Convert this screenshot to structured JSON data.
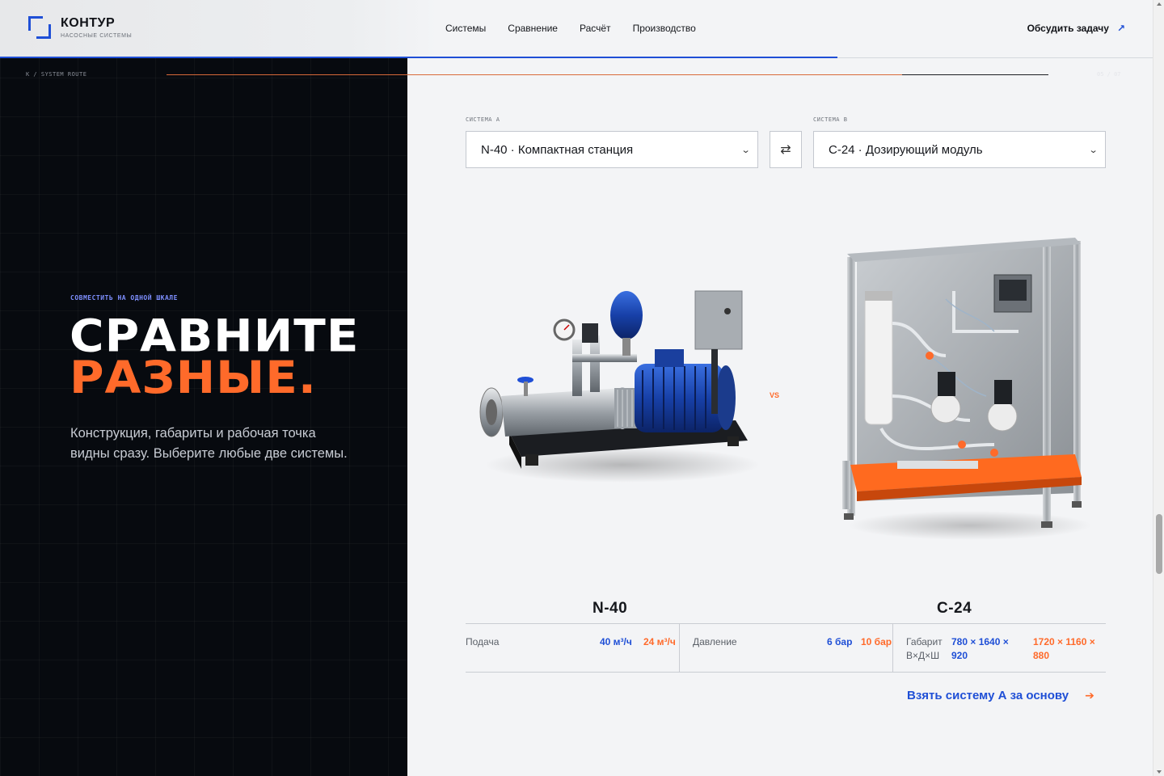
{
  "brand": {
    "name": "КОНТУР",
    "tagline": "НАСОСНЫЕ СИСТЕМЫ"
  },
  "nav": [
    "Системы",
    "Сравнение",
    "Расчёт",
    "Производство"
  ],
  "cta": {
    "label": "Обсудить задачу",
    "icon": "arrow-up-right-icon"
  },
  "route": {
    "label": "К / SYSTEM ROUTE",
    "count": "05 / 07"
  },
  "hero": {
    "eyebrow": "СОВМЕСТИТЬ НА ОДНОЙ ШКАЛЕ",
    "title_line1": "СРАВНИТЕ",
    "title_line2": "РАЗНЫЕ.",
    "description": "Конструкция, габариты и рабочая точка видны сразу. Выберите любые две системы."
  },
  "selectors": {
    "a": {
      "label": "СИСТЕМА А",
      "value": "N-40 · Компактная станция"
    },
    "b": {
      "label": "СИСТЕМА В",
      "value": "С-24 · Дозирующий модуль"
    },
    "swap_icon": "swap-arrows-icon"
  },
  "compare": {
    "vs": "VS",
    "product_a": "N-40",
    "product_b": "С-24"
  },
  "specs": [
    {
      "label": "Подача",
      "a": "40 м³/ч",
      "b": "24 м³/ч"
    },
    {
      "label": "Давление",
      "a": "6 бар",
      "b": "10 бар"
    },
    {
      "label": "Габарит В×Д×Ш",
      "a": "780 × 1640 × 920",
      "b": "1720 × 1160 × 880"
    }
  ],
  "base_link": "Взять систему А за основу",
  "colors": {
    "accent_blue": "#1f4fd6",
    "accent_orange": "#ff6a2a",
    "dark_panel": "#070a0f"
  }
}
